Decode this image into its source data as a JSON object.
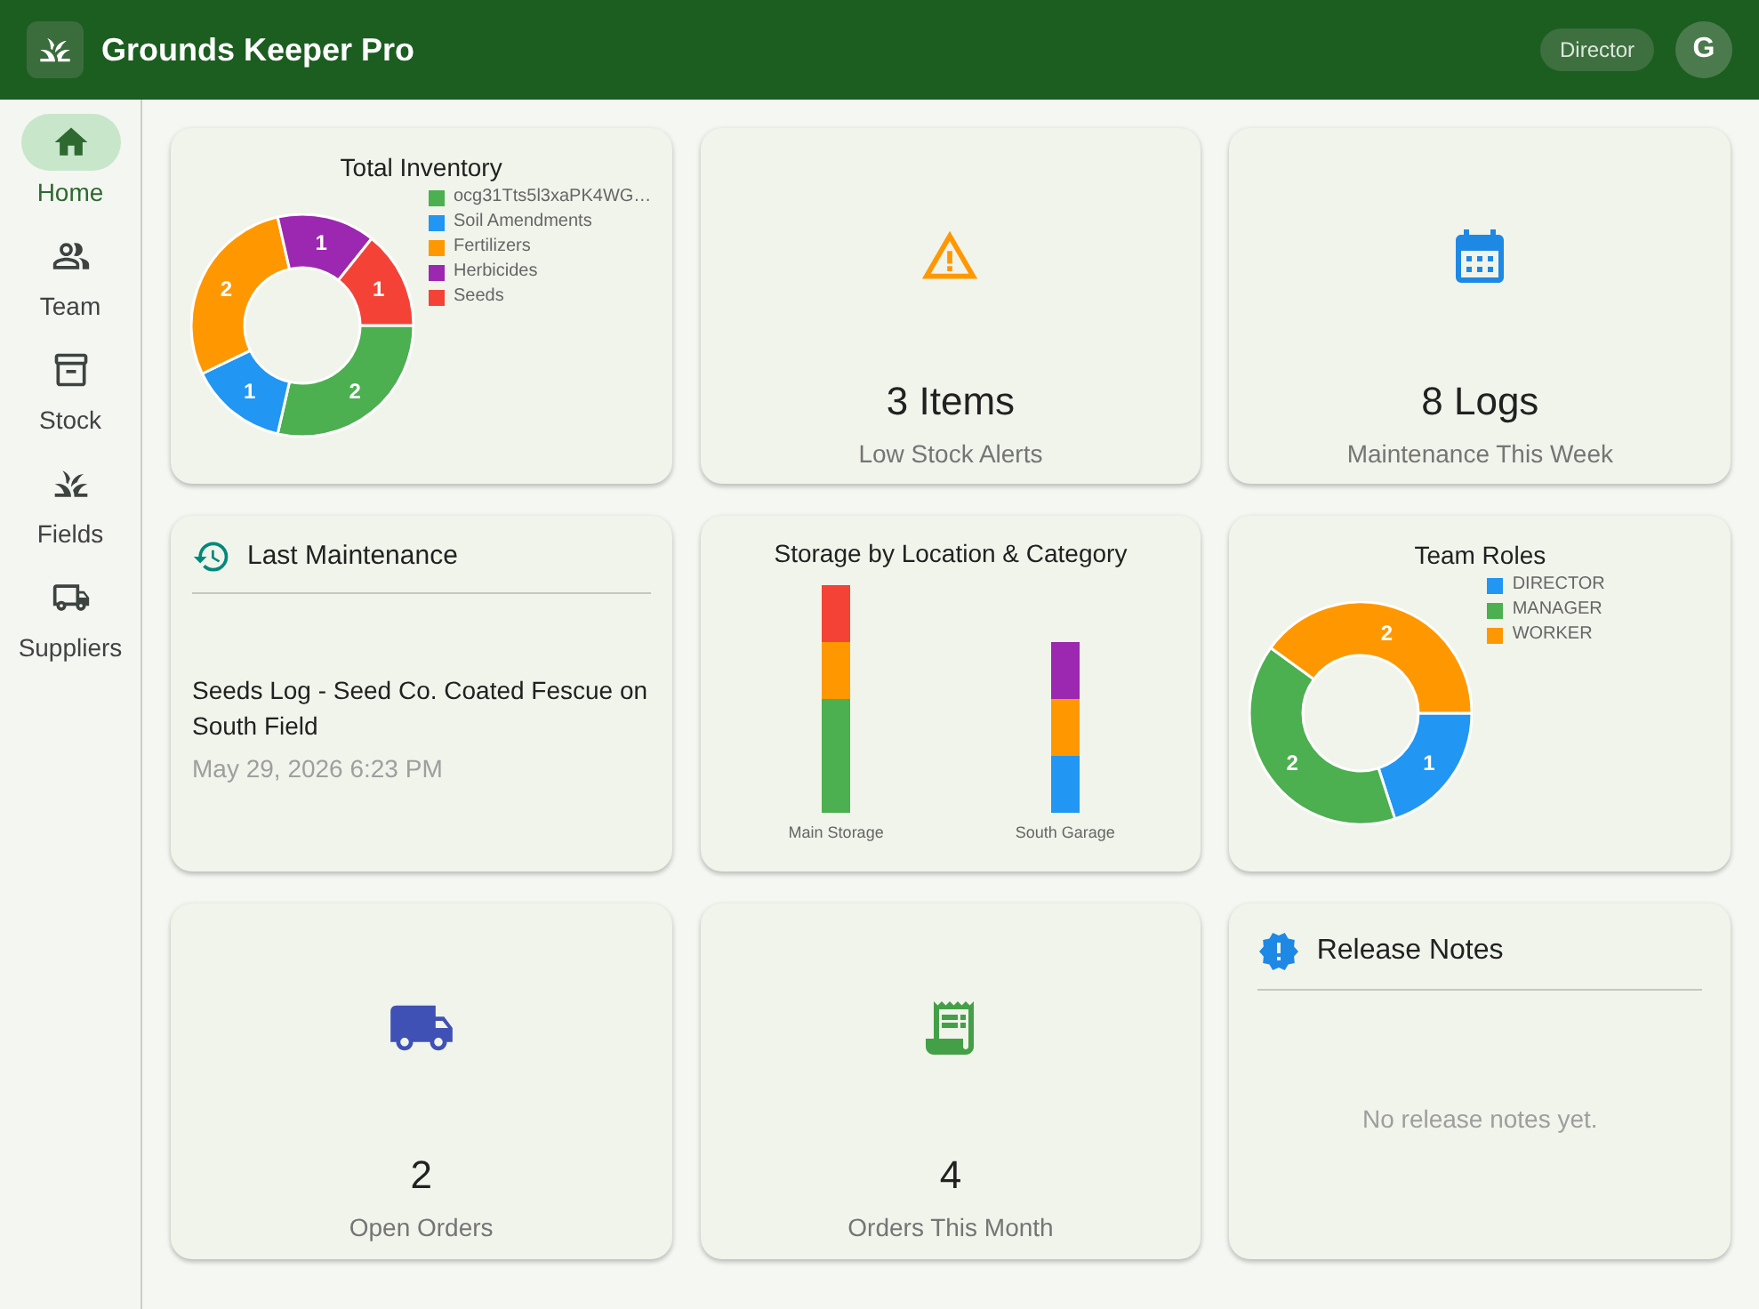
{
  "header": {
    "title": "Grounds Keeper Pro",
    "role": "Director",
    "avatar_initial": "G"
  },
  "sidebar": {
    "items": [
      {
        "label": "Home",
        "selected": true
      },
      {
        "label": "Team",
        "selected": false
      },
      {
        "label": "Stock",
        "selected": false
      },
      {
        "label": "Fields",
        "selected": false
      },
      {
        "label": "Suppliers",
        "selected": false
      }
    ]
  },
  "inventory": {
    "chart_data": {
      "type": "donut",
      "title": "Total Inventory",
      "categories": [
        "ocg31Tts5l3xaPK4WG…",
        "Soil Amendments",
        "Fertilizers",
        "Herbicides",
        "Seeds"
      ],
      "values": [
        2,
        1,
        2,
        1,
        1
      ],
      "colors": [
        "#4caf50",
        "#2196f3",
        "#ff9800",
        "#9c27b0",
        "#f44336"
      ],
      "data_labels": true,
      "legend": "right"
    }
  },
  "low_stock": {
    "value": "3 Items",
    "label": "Low Stock Alerts"
  },
  "maintenance_week": {
    "value": "8 Logs",
    "label": "Maintenance This Week"
  },
  "last_maintenance": {
    "title": "Last Maintenance",
    "entry": "Seeds Log - Seed Co. Coated Fescue on South Field",
    "timestamp": "May 29, 2026 6:23 PM"
  },
  "storage": {
    "title": "Storage by Location & Category",
    "categories": [
      "Main Storage",
      "South Garage"
    ]
  },
  "team_roles": {
    "chart_data": {
      "type": "donut",
      "title": "Team Roles",
      "categories": [
        "DIRECTOR",
        "MANAGER",
        "WORKER"
      ],
      "values": [
        1,
        2,
        2
      ],
      "colors": [
        "#2196f3",
        "#4caf50",
        "#ff9800"
      ],
      "data_labels": true,
      "legend": "right"
    }
  },
  "open_orders": {
    "value": "2",
    "label": "Open Orders"
  },
  "orders_month": {
    "value": "4",
    "label": "Orders This Month"
  },
  "release_notes": {
    "title": "Release Notes",
    "empty_message": "No release notes yet."
  }
}
